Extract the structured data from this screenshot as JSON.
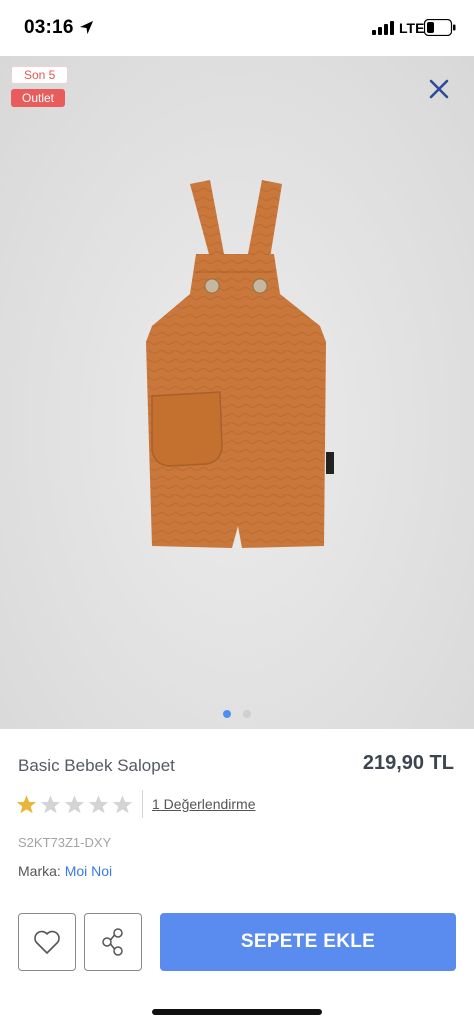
{
  "status_bar": {
    "time": "03:16",
    "network": "LTE",
    "icons": [
      "location-arrow-icon",
      "signal-bars-icon",
      "battery-icon"
    ]
  },
  "hero": {
    "badges": {
      "stock": "Son 5",
      "outlet": "Outlet"
    },
    "carousel": {
      "count": 2,
      "active": 0
    },
    "close_icon": "close-icon",
    "colors": {
      "garment": "#c9773a",
      "outlet_badge": "#ea5b5b",
      "dot_active": "#4d8ef0"
    }
  },
  "product": {
    "name": "Basic Bebek Salopet",
    "price": "219,90 TL",
    "rating": {
      "value": 1,
      "max": 5,
      "review_text": "1 Değerlendirme"
    },
    "sku": "S2KT73Z1-DXY",
    "brand_label": "Marka:",
    "brand_value": "Moi Noi"
  },
  "actions": {
    "add_to_cart": "SEPETE EKLE",
    "favorite_icon": "heart-icon",
    "share_icon": "share-icon",
    "accent": "#5a8cf0"
  }
}
